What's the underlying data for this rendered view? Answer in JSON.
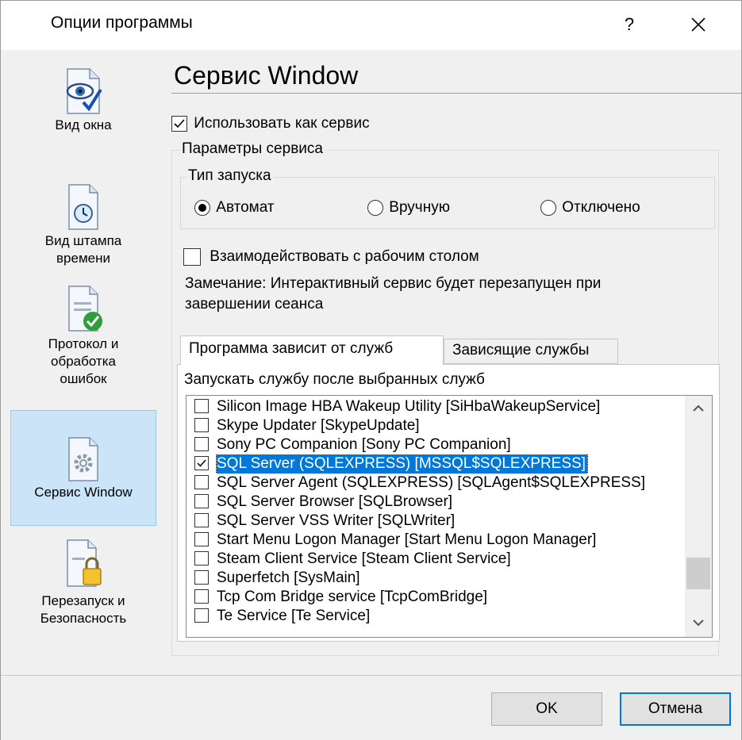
{
  "window": {
    "title": "Опции программы",
    "help_label": "?"
  },
  "sidebar": {
    "items": [
      {
        "label1": "Вид окна",
        "label2": ""
      },
      {
        "label1": "Вид штампа",
        "label2": "времени"
      },
      {
        "label1": "Протокол и",
        "label2": "обработка",
        "label3": "ошибок"
      },
      {
        "label1": "Сервис Window",
        "label2": ""
      },
      {
        "label1": "Перезапуск и",
        "label2": "Безопасность"
      }
    ]
  },
  "main": {
    "heading": "Сервис Window",
    "use_as_service_label": "Использовать как сервис",
    "use_as_service_checked": true,
    "service_params_legend": "Параметры сервиса",
    "startup_type_legend": "Тип запуска",
    "startup_options": [
      "Автомат",
      "Вручную",
      "Отключено"
    ],
    "startup_selected": "Автомат",
    "interact_desktop_label": "Взаимодействовать с рабочим столом",
    "interact_desktop_checked": false,
    "note_line1": "Замечание: Интерактивный сервис будет перезапущен при",
    "note_line2": "завершении сеанса",
    "tabs": [
      "Программа зависит от служб",
      "Зависящие службы"
    ],
    "active_tab": "Программа зависит от служб",
    "list_caption": "Запускать службу после выбранных служб",
    "services": [
      {
        "name": "Silicon Image HBA Wakeup Utility [SiHbaWakeupService]",
        "checked": false
      },
      {
        "name": "Skype Updater [SkypeUpdate]",
        "checked": false
      },
      {
        "name": "Sony PC Companion [Sony PC Companion]",
        "checked": false
      },
      {
        "name": "SQL Server (SQLEXPRESS) [MSSQL$SQLEXPRESS]",
        "checked": true,
        "selected": true
      },
      {
        "name": "SQL Server Agent (SQLEXPRESS) [SQLAgent$SQLEXPRESS]",
        "checked": false
      },
      {
        "name": "SQL Server Browser [SQLBrowser]",
        "checked": false
      },
      {
        "name": "SQL Server VSS Writer [SQLWriter]",
        "checked": false
      },
      {
        "name": "Start Menu Logon Manager [Start Menu Logon Manager]",
        "checked": false
      },
      {
        "name": "Steam Client Service [Steam Client Service]",
        "checked": false
      },
      {
        "name": "Superfetch [SysMain]",
        "checked": false
      },
      {
        "name": "Tcp Com Bridge service [TcpComBridge]",
        "checked": false
      },
      {
        "name": "Te Service [Te Service]",
        "checked": false
      }
    ]
  },
  "buttons": {
    "ok_label": "OK",
    "cancel_label": "Отмена"
  },
  "colors": {
    "selection": "#0078d7",
    "sidebar_active": "#cce4f7",
    "dialog_bg": "#f0f0f0"
  }
}
